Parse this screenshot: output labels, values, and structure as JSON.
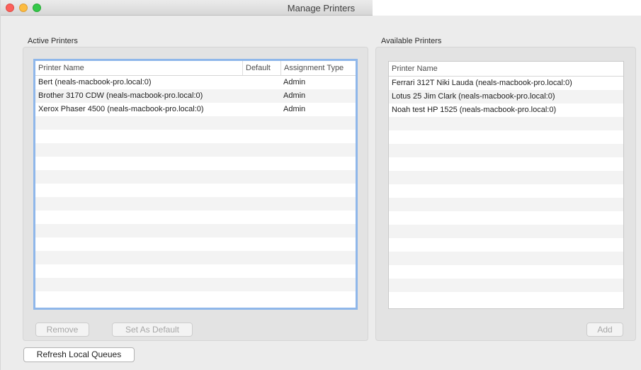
{
  "window": {
    "title": "Manage Printers"
  },
  "active_printers": {
    "label": "Active Printers",
    "columns": [
      "Printer Name",
      "Default",
      "Assignment Type"
    ],
    "rows": [
      {
        "name": "Bert (neals-macbook-pro.local:0)",
        "default": "",
        "assignment": "Admin"
      },
      {
        "name": "Brother 3170 CDW (neals-macbook-pro.local:0)",
        "default": "",
        "assignment": "Admin"
      },
      {
        "name": "Xerox Phaser 4500 (neals-macbook-pro.local:0)",
        "default": "",
        "assignment": "Admin"
      }
    ],
    "remove_label": "Remove",
    "set_default_label": "Set As Default"
  },
  "available_printers": {
    "label": "Available Printers",
    "columns": [
      "Printer Name"
    ],
    "rows": [
      {
        "name": "Ferrari 312T Niki Lauda (neals-macbook-pro.local:0)"
      },
      {
        "name": "Lotus 25 Jim Clark (neals-macbook-pro.local:0)"
      },
      {
        "name": "Noah test HP 1525 (neals-macbook-pro.local:0)"
      }
    ],
    "add_label": "Add"
  },
  "refresh_label": "Refresh Local Queues"
}
